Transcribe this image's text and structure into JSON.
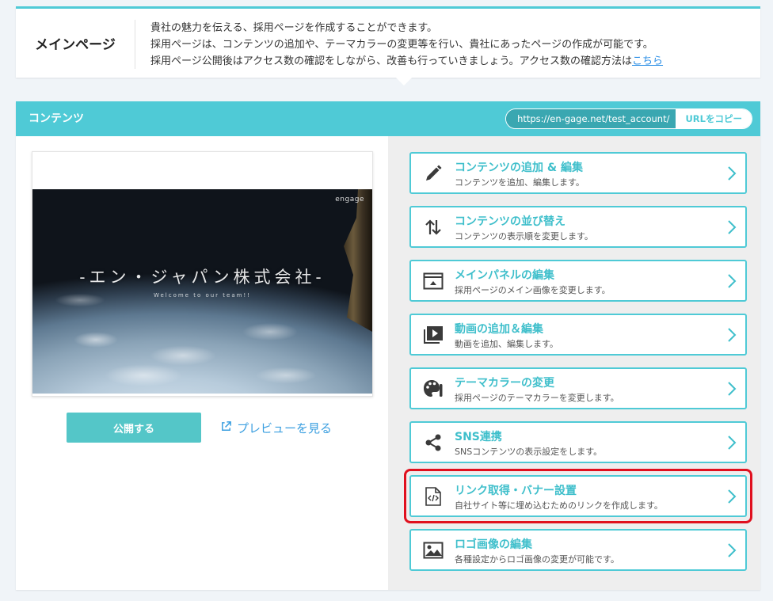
{
  "info": {
    "title": "メインページ",
    "line1": "貴社の魅力を伝える、採用ページを作成することができます。",
    "line2": "採用ページは、コンテンツの追加や、テーマカラーの変更等を行い、貴社にあったページの作成が可能です。",
    "line3": "採用ページ公開後はアクセス数の確認をしながら、改善も行っていきましょう。アクセス数の確認方法は",
    "link": "こちら"
  },
  "panel": {
    "title": "コンテンツ",
    "url": "https://en-gage.net/test_account/",
    "copy_label": "URLをコピー"
  },
  "preview": {
    "logo": "engage",
    "company": "-エン・ジャパン株式会社-",
    "subtitle": "Welcome to our team!!",
    "publish_label": "公開する",
    "preview_label": "プレビューを見る"
  },
  "menu": [
    {
      "icon": "pencil-icon",
      "title": "コンテンツの追加 & 編集",
      "desc": "コンテンツを追加、編集します。"
    },
    {
      "icon": "sort-arrows-icon",
      "title": "コンテンツの並び替え",
      "desc": "コンテンツの表示順を変更します。"
    },
    {
      "icon": "panel-image-icon",
      "title": "メインパネルの編集",
      "desc": "採用ページのメイン画像を変更します。"
    },
    {
      "icon": "video-play-icon",
      "title": "動画の追加＆編集",
      "desc": "動画を追加、編集します。"
    },
    {
      "icon": "palette-icon",
      "title": "テーマカラーの変更",
      "desc": "採用ページのテーマカラーを変更します。"
    },
    {
      "icon": "share-icon",
      "title": "SNS連携",
      "desc": "SNSコンテンツの表示設定をします。"
    },
    {
      "icon": "code-file-icon",
      "title": "リンク取得・バナー設置",
      "desc": "自社サイト等に埋め込むためのリンクを作成します。"
    },
    {
      "icon": "image-icon",
      "title": "ロゴ画像の編集",
      "desc": "各種設定からロゴ画像の変更が可能です。"
    }
  ],
  "colors": {
    "accent": "#4fcad6",
    "highlight": "#e0101e",
    "link": "#3b9fe0"
  }
}
